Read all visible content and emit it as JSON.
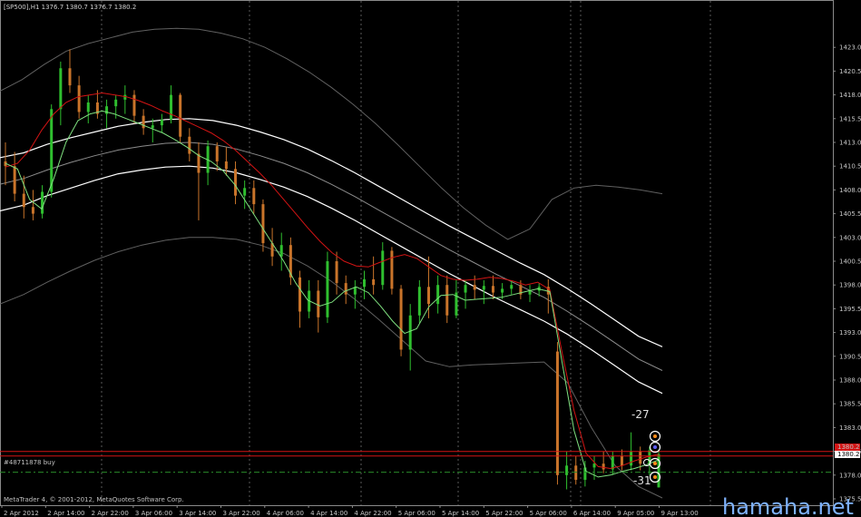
{
  "header": {
    "symbol_line": "[SP500],H1  1376.7 1380.7 1376.7 1380.2"
  },
  "footer": {
    "copyright": "MetaTrader 4, © 2001-2012, MetaQuotes Software Corp.",
    "watermark": "hamaha.net"
  },
  "order_label": "#48711878 buy",
  "annotations": {
    "upper": "-27",
    "lower": "-31"
  },
  "price_tags": {
    "current_price": "1380.2",
    "order_price": "1380.2"
  },
  "colors": {
    "background": "#000000",
    "grid": "#5a5a5a",
    "bull_candle": "#2fbf2f",
    "bear_candle": "#c9742a",
    "red_ma": "#d41414",
    "green_ma": "#7fe07f",
    "white_band": "#ffffff",
    "outer_band": "#606060",
    "order_line": "#2a8a2a",
    "price_line": "#d41414",
    "watermark": "#7fb3ff"
  },
  "chart_data": {
    "type": "candlestick",
    "symbol": "[SP500],H1",
    "ohlc_header": {
      "open": 1376.7,
      "high": 1380.7,
      "low": 1376.7,
      "close": 1380.2
    },
    "ylim": [
      1375.5,
      1425.5
    ],
    "y_ticks": [
      "1423.0",
      "1420.5",
      "1418.0",
      "1415.5",
      "1413.0",
      "1410.5",
      "1408.0",
      "1405.5",
      "1403.0",
      "1400.5",
      "1398.0",
      "1395.5",
      "1393.0",
      "1390.5",
      "1388.0",
      "1385.5",
      "1383.0",
      "1380.5",
      "1378.0",
      "1375.5"
    ],
    "x_ticks": [
      "2 Apr 2012",
      "2 Apr 14:00",
      "2 Apr 22:00",
      "3 Apr 06:00",
      "3 Apr 14:00",
      "3 Apr 22:00",
      "4 Apr 06:00",
      "4 Apr 14:00",
      "4 Apr 22:00",
      "5 Apr 06:00",
      "5 Apr 14:00",
      "5 Apr 22:00",
      "5 Apr 06:00",
      "6 Apr 14:00",
      "9 Apr 05:00",
      "9 Apr 13:00"
    ],
    "day_separators_after_tick": [
      1,
      5,
      9,
      13
    ],
    "current_price": 1380.2,
    "order": {
      "label": "#48711878 buy",
      "price": 1378.3
    },
    "series": [
      {
        "name": "",
        "color": "#d41414",
        "role": "red_ma",
        "values": [
          1410.4,
          1410.8,
          1412.2,
          1414.3,
          1416.0,
          1417.2,
          1417.8,
          1418.0,
          1418.2,
          1418.0,
          1417.8,
          1417.4,
          1416.9,
          1416.3,
          1415.8,
          1415.2,
          1414.6,
          1414.0,
          1413.2,
          1412.2,
          1411.0,
          1409.8,
          1408.5,
          1407.0,
          1405.5,
          1404.0,
          1402.6,
          1401.4,
          1400.5,
          1400.0,
          1399.9,
          1400.4,
          1400.9,
          1401.2,
          1400.8,
          1399.9,
          1399.0,
          1398.6,
          1398.5,
          1398.6,
          1398.8,
          1398.7,
          1398.4,
          1398.0,
          1398.3,
          1397.5,
          1391.0,
          1384.8,
          1380.3,
          1378.9,
          1378.7,
          1379.0,
          1379.5,
          1379.9,
          1380.2
        ]
      },
      {
        "name": "",
        "color": "#7fe07f",
        "role": "green_ma",
        "values": [
          1410.8,
          1410.2,
          1407.0,
          1406.0,
          1409.2,
          1413.0,
          1415.3,
          1416.0,
          1416.3,
          1416.0,
          1415.5,
          1415.0,
          1414.5,
          1414.0,
          1413.3,
          1412.5,
          1411.6,
          1411.0,
          1410.0,
          1408.5,
          1406.5,
          1404.5,
          1402.5,
          1400.5,
          1398.2,
          1396.4,
          1395.8,
          1396.2,
          1397.3,
          1397.8,
          1397.2,
          1395.8,
          1394.2,
          1392.9,
          1393.4,
          1395.7,
          1396.9,
          1397.0,
          1396.4,
          1396.5,
          1396.6,
          1396.7,
          1397.0,
          1397.3,
          1397.6,
          1397.3,
          1390.0,
          1382.7,
          1378.4,
          1377.8,
          1378.0,
          1378.4,
          1378.7,
          1379.1,
          1379.6
        ]
      },
      {
        "name": "",
        "color": "#ffffff",
        "role": "white_upper",
        "values": [
          1411.4,
          1411.9,
          1412.8,
          1413.5,
          1414.1,
          1414.7,
          1415.1,
          1415.4,
          1415.5,
          1415.3,
          1414.8,
          1414.1,
          1413.3,
          1412.3,
          1411.1,
          1409.8,
          1408.4,
          1407.0,
          1405.6,
          1404.2,
          1402.9,
          1401.6,
          1400.3,
          1399.1,
          1397.6,
          1396.0,
          1394.3,
          1392.6,
          1391.5
        ]
      },
      {
        "name": "",
        "color": "#8c8c8c",
        "role": "white_middle",
        "values": [
          1408.6,
          1409.2,
          1410.1,
          1410.9,
          1411.6,
          1412.2,
          1412.6,
          1412.9,
          1413.0,
          1412.8,
          1412.3,
          1411.6,
          1410.8,
          1409.8,
          1408.6,
          1407.3,
          1405.9,
          1404.5,
          1403.1,
          1401.7,
          1400.4,
          1399.1,
          1397.9,
          1396.7,
          1395.2,
          1393.6,
          1391.9,
          1390.2,
          1389.0
        ]
      },
      {
        "name": "",
        "color": "#ffffff",
        "role": "white_lower",
        "values": [
          1405.8,
          1406.4,
          1407.4,
          1408.2,
          1409.0,
          1409.7,
          1410.1,
          1410.4,
          1410.5,
          1410.3,
          1409.8,
          1409.1,
          1408.3,
          1407.3,
          1406.1,
          1404.8,
          1403.4,
          1402.0,
          1400.6,
          1399.2,
          1397.9,
          1396.6,
          1395.4,
          1394.2,
          1392.8,
          1391.2,
          1389.5,
          1387.8,
          1386.6
        ]
      },
      {
        "name": "",
        "color": "#606060",
        "role": "outer_upper",
        "values": [
          1418.4,
          1419.6,
          1421.2,
          1422.6,
          1423.4,
          1424.0,
          1424.6,
          1424.9,
          1425.0,
          1424.9,
          1424.5,
          1423.9,
          1423.0,
          1421.8,
          1420.4,
          1418.8,
          1417.0,
          1415.0,
          1412.8,
          1410.5,
          1408.2,
          1406.1,
          1404.3,
          1402.8,
          1403.9,
          1407.0,
          1408.2,
          1408.5,
          1408.3,
          1408.0,
          1407.6
        ]
      },
      {
        "name": "",
        "color": "#606060",
        "role": "outer_lower",
        "values": [
          1396.0,
          1397.0,
          1398.3,
          1399.5,
          1400.6,
          1401.5,
          1402.2,
          1402.7,
          1403.0,
          1403.0,
          1402.8,
          1402.2,
          1401.3,
          1400.0,
          1398.4,
          1396.5,
          1394.4,
          1392.2,
          1390.0,
          1389.4,
          1389.6,
          1389.7,
          1389.8,
          1389.9,
          1387.7,
          1383.0,
          1379.0,
          1376.8,
          1375.6
        ]
      }
    ],
    "candles": [
      {
        "o": 1411.0,
        "h": 1413.0,
        "l": 1408.5,
        "c": 1410.5
      },
      {
        "o": 1410.5,
        "h": 1412.0,
        "l": 1406.8,
        "c": 1407.6
      },
      {
        "o": 1407.6,
        "h": 1409.5,
        "l": 1405.0,
        "c": 1406.2
      },
      {
        "o": 1406.2,
        "h": 1408.0,
        "l": 1404.8,
        "c": 1405.5
      },
      {
        "o": 1405.5,
        "h": 1408.5,
        "l": 1405.0,
        "c": 1407.8
      },
      {
        "o": 1407.8,
        "h": 1417.0,
        "l": 1407.2,
        "c": 1416.5
      },
      {
        "o": 1416.5,
        "h": 1421.5,
        "l": 1414.8,
        "c": 1420.8
      },
      {
        "o": 1420.8,
        "h": 1422.8,
        "l": 1418.2,
        "c": 1419.0
      },
      {
        "o": 1419.0,
        "h": 1420.0,
        "l": 1415.5,
        "c": 1416.2
      },
      {
        "o": 1416.2,
        "h": 1418.0,
        "l": 1415.0,
        "c": 1417.2
      },
      {
        "o": 1417.2,
        "h": 1418.5,
        "l": 1415.5,
        "c": 1416.0
      },
      {
        "o": 1416.0,
        "h": 1417.5,
        "l": 1414.5,
        "c": 1416.8
      },
      {
        "o": 1416.8,
        "h": 1418.0,
        "l": 1415.5,
        "c": 1417.5
      },
      {
        "o": 1417.5,
        "h": 1419.0,
        "l": 1416.0,
        "c": 1418.0
      },
      {
        "o": 1418.0,
        "h": 1418.5,
        "l": 1415.0,
        "c": 1415.8
      },
      {
        "o": 1415.8,
        "h": 1416.5,
        "l": 1413.8,
        "c": 1414.5
      },
      {
        "o": 1414.5,
        "h": 1415.5,
        "l": 1413.0,
        "c": 1414.8
      },
      {
        "o": 1414.8,
        "h": 1416.0,
        "l": 1414.0,
        "c": 1415.4
      },
      {
        "o": 1415.4,
        "h": 1419.0,
        "l": 1415.0,
        "c": 1418.0
      },
      {
        "o": 1418.0,
        "h": 1418.2,
        "l": 1413.0,
        "c": 1413.6
      },
      {
        "o": 1413.6,
        "h": 1414.5,
        "l": 1411.0,
        "c": 1411.8
      },
      {
        "o": 1411.8,
        "h": 1413.0,
        "l": 1404.8,
        "c": 1409.8
      },
      {
        "o": 1409.8,
        "h": 1413.2,
        "l": 1408.5,
        "c": 1412.6
      },
      {
        "o": 1412.6,
        "h": 1413.0,
        "l": 1410.0,
        "c": 1411.0
      },
      {
        "o": 1411.0,
        "h": 1412.5,
        "l": 1409.5,
        "c": 1410.2
      },
      {
        "o": 1410.2,
        "h": 1411.0,
        "l": 1406.5,
        "c": 1407.4
      },
      {
        "o": 1407.4,
        "h": 1409.0,
        "l": 1406.0,
        "c": 1408.2
      },
      {
        "o": 1408.2,
        "h": 1409.0,
        "l": 1405.5,
        "c": 1406.5
      },
      {
        "o": 1406.5,
        "h": 1407.0,
        "l": 1401.5,
        "c": 1402.4
      },
      {
        "o": 1402.4,
        "h": 1404.0,
        "l": 1400.0,
        "c": 1401.0
      },
      {
        "o": 1401.0,
        "h": 1403.5,
        "l": 1399.5,
        "c": 1402.2
      },
      {
        "o": 1402.2,
        "h": 1403.0,
        "l": 1398.0,
        "c": 1398.8
      },
      {
        "o": 1398.8,
        "h": 1399.5,
        "l": 1393.5,
        "c": 1395.2
      },
      {
        "o": 1395.2,
        "h": 1398.5,
        "l": 1394.5,
        "c": 1397.4
      },
      {
        "o": 1397.4,
        "h": 1398.5,
        "l": 1393.0,
        "c": 1394.6
      },
      {
        "o": 1394.6,
        "h": 1401.5,
        "l": 1394.0,
        "c": 1400.5
      },
      {
        "o": 1400.5,
        "h": 1401.5,
        "l": 1397.0,
        "c": 1398.2
      },
      {
        "o": 1398.2,
        "h": 1399.0,
        "l": 1396.0,
        "c": 1397.0
      },
      {
        "o": 1397.0,
        "h": 1398.5,
        "l": 1395.5,
        "c": 1397.8
      },
      {
        "o": 1397.8,
        "h": 1399.5,
        "l": 1396.5,
        "c": 1398.6
      },
      {
        "o": 1398.6,
        "h": 1401.0,
        "l": 1397.0,
        "c": 1398.0
      },
      {
        "o": 1398.0,
        "h": 1402.5,
        "l": 1397.5,
        "c": 1401.6
      },
      {
        "o": 1401.6,
        "h": 1402.0,
        "l": 1397.0,
        "c": 1397.6
      },
      {
        "o": 1397.6,
        "h": 1398.0,
        "l": 1390.5,
        "c": 1391.2
      },
      {
        "o": 1391.2,
        "h": 1396.0,
        "l": 1389.0,
        "c": 1394.8
      },
      {
        "o": 1394.8,
        "h": 1398.5,
        "l": 1394.0,
        "c": 1397.8
      },
      {
        "o": 1397.8,
        "h": 1401.0,
        "l": 1394.5,
        "c": 1396.0
      },
      {
        "o": 1396.0,
        "h": 1399.0,
        "l": 1395.0,
        "c": 1398.0
      },
      {
        "o": 1398.0,
        "h": 1399.0,
        "l": 1394.0,
        "c": 1394.8
      },
      {
        "o": 1394.8,
        "h": 1398.5,
        "l": 1394.5,
        "c": 1397.2
      },
      {
        "o": 1397.2,
        "h": 1398.5,
        "l": 1395.5,
        "c": 1398.0
      },
      {
        "o": 1398.0,
        "h": 1399.0,
        "l": 1396.5,
        "c": 1397.5
      },
      {
        "o": 1397.5,
        "h": 1398.5,
        "l": 1396.0,
        "c": 1397.9
      },
      {
        "o": 1397.9,
        "h": 1399.0,
        "l": 1396.5,
        "c": 1397.2
      },
      {
        "o": 1397.2,
        "h": 1398.2,
        "l": 1396.5,
        "c": 1397.6
      },
      {
        "o": 1397.6,
        "h": 1398.5,
        "l": 1397.0,
        "c": 1398.0
      },
      {
        "o": 1398.0,
        "h": 1398.5,
        "l": 1396.5,
        "c": 1397.0
      },
      {
        "o": 1397.0,
        "h": 1398.0,
        "l": 1396.2,
        "c": 1397.4
      },
      {
        "o": 1397.4,
        "h": 1398.2,
        "l": 1396.8,
        "c": 1397.8
      },
      {
        "o": 1397.8,
        "h": 1398.6,
        "l": 1395.0,
        "c": 1397.0
      },
      {
        "o": 1391.0,
        "h": 1392.0,
        "l": 1377.0,
        "c": 1378.0
      },
      {
        "o": 1378.0,
        "h": 1380.5,
        "l": 1376.5,
        "c": 1379.0
      },
      {
        "o": 1379.0,
        "h": 1380.0,
        "l": 1377.0,
        "c": 1377.5
      },
      {
        "o": 1377.5,
        "h": 1379.5,
        "l": 1376.8,
        "c": 1378.8
      },
      {
        "o": 1378.8,
        "h": 1380.0,
        "l": 1377.5,
        "c": 1379.2
      },
      {
        "o": 1379.2,
        "h": 1380.5,
        "l": 1378.2,
        "c": 1378.6
      },
      {
        "o": 1378.6,
        "h": 1380.5,
        "l": 1378.0,
        "c": 1380.0
      },
      {
        "o": 1380.0,
        "h": 1380.7,
        "l": 1378.5,
        "c": 1379.0
      },
      {
        "o": 1379.0,
        "h": 1382.5,
        "l": 1378.5,
        "c": 1380.5
      },
      {
        "o": 1380.5,
        "h": 1381.0,
        "l": 1378.5,
        "c": 1379.2
      },
      {
        "o": 1379.2,
        "h": 1381.0,
        "l": 1378.0,
        "c": 1380.6
      },
      {
        "o": 1376.7,
        "h": 1380.7,
        "l": 1376.7,
        "c": 1380.2
      }
    ]
  }
}
